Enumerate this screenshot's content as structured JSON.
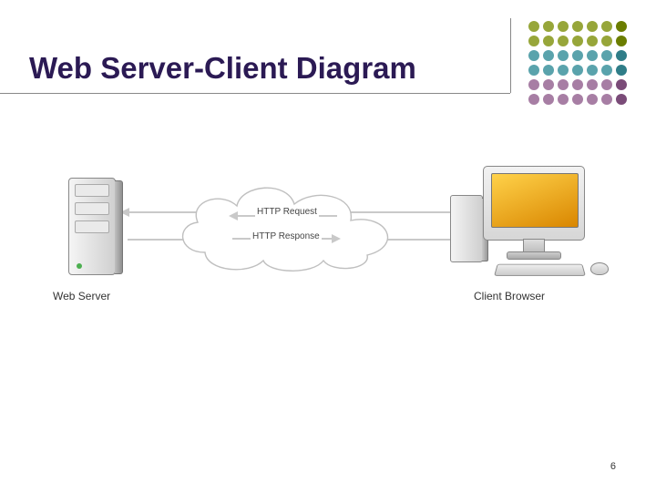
{
  "title": "Web Server-Client Diagram",
  "server_label": "Web Server",
  "client_label": "Client Browser",
  "arrows": {
    "request": "HTTP Request",
    "response": "HTTP Response"
  },
  "icons": {
    "server": "server-tower",
    "cloud": "network-cloud",
    "client": "desktop-computer"
  },
  "accent_dot_colors": {
    "olive": "#6b7d00",
    "teal": "#2f7d88",
    "plum": "#7a4b78"
  },
  "page_number": "6"
}
